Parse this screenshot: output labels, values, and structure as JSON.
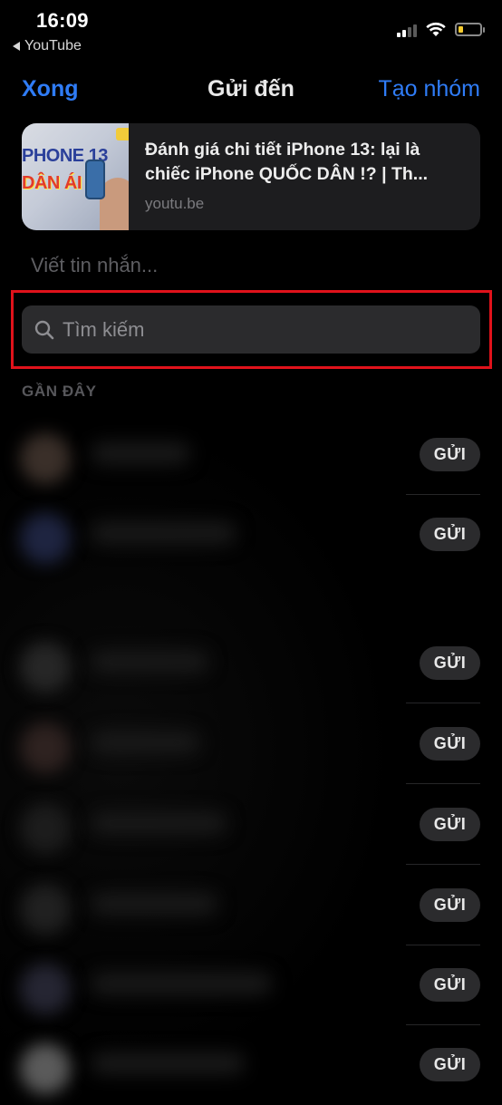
{
  "status_bar": {
    "time": "16:09",
    "back_app": "YouTube",
    "back_icon": "back-triangle",
    "signal_icon": "cellular-signal",
    "wifi_icon": "wifi",
    "battery_icon": "battery-low",
    "battery_color": "#f7cc2f"
  },
  "nav": {
    "left_label": "Xong",
    "title": "Gửi đến",
    "right_label": "Tạo nhóm",
    "accent_color": "#2f7cf6"
  },
  "link_card": {
    "thumbnail_icon": "video-thumbnail",
    "thumbnail_text_1": "PHONE 13",
    "thumbnail_text_2": "DÂN ÁI !!!",
    "title": "Đánh giá chi tiết iPhone 13: lại là chiếc iPhone QUỐC DÂN !? | Th...",
    "domain": "youtu.be"
  },
  "message": {
    "placeholder": "Viết tin nhắn..."
  },
  "search": {
    "icon": "search-icon",
    "placeholder": "Tìm kiếm",
    "highlight_color": "#e0121b"
  },
  "section": {
    "label": "GẦN ĐÂY"
  },
  "contacts": [
    {
      "send_label": "GỬI"
    },
    {
      "send_label": "GỬI"
    },
    {
      "send_label": "GỬI"
    },
    {
      "send_label": "GỬI"
    },
    {
      "send_label": "GỬI"
    },
    {
      "send_label": "GỬI"
    },
    {
      "send_label": "GỬI"
    },
    {
      "send_label": "GỬI"
    }
  ]
}
